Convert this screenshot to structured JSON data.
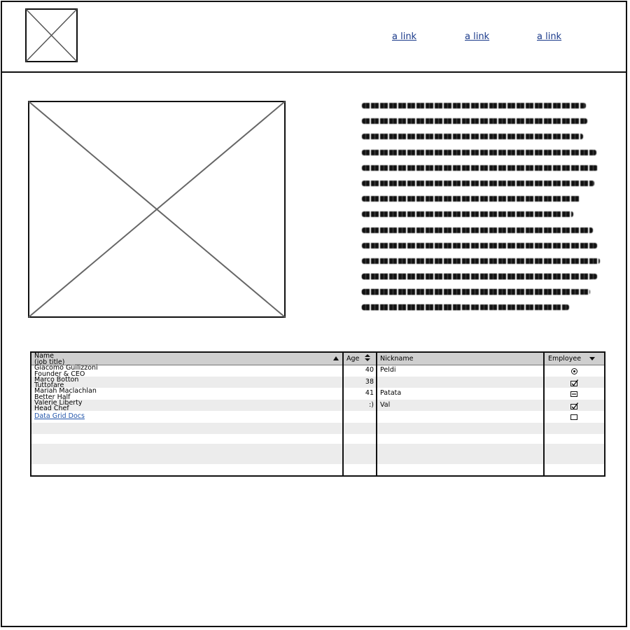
{
  "header": {
    "logo_icon": "image-placeholder-icon",
    "nav_links": [
      "a link",
      "a link",
      "a link"
    ]
  },
  "hero": {
    "image_icon": "image-placeholder-icon"
  },
  "body_text": {
    "paragraph_1_icon": "scribbled-text-placeholder",
    "paragraph_2_icon": "scribbled-text-placeholder"
  },
  "data_grid": {
    "columns": [
      "Name\n(job title)",
      "Age",
      "Nickname",
      "Employee"
    ],
    "sort_icons": {
      "name": "sort-ascending-icon",
      "age": "sort-both-icon",
      "employee": "sort-descending-icon"
    },
    "rows": [
      {
        "name": "Giacomo Guilizzoni",
        "title": "Founder & CEO",
        "age": "40",
        "nickname": "Peldi",
        "employee": "radio-selected"
      },
      {
        "name": "Marco Botton",
        "title": "Tuttofare",
        "age": "38",
        "nickname": "",
        "employee": "checked"
      },
      {
        "name": "Mariah Maclachlan",
        "title": "Better Half",
        "age": "41",
        "nickname": "Patata",
        "employee": "indeterminate"
      },
      {
        "name": "Valerie Liberty",
        "title": "Head Chef",
        "age": ":)",
        "nickname": "Val",
        "employee": "checked"
      }
    ],
    "docs_link": "Data Grid Docs",
    "docs_employee": "unchecked"
  }
}
